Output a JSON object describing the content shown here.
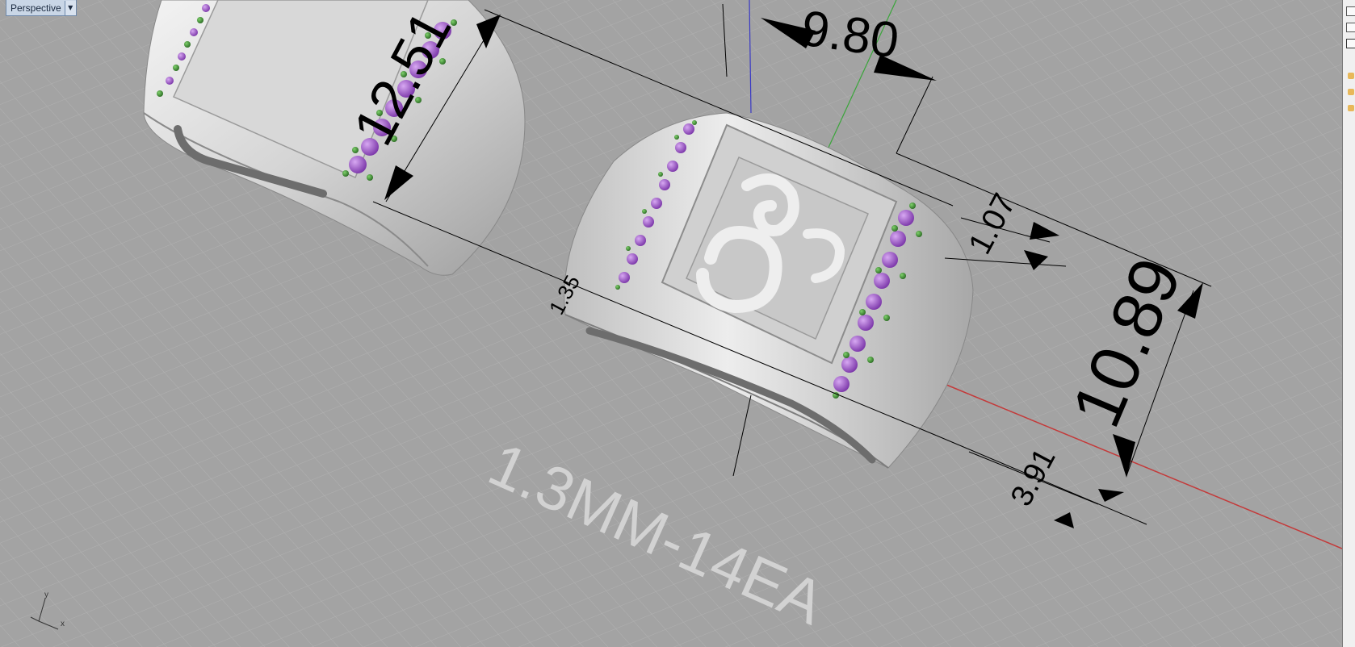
{
  "viewport": {
    "title": "Perspective",
    "menu_icon": "chevron-down-icon",
    "engraving_text": "1.3MM-14EA",
    "axis_labels": {
      "x": "x",
      "y": "y"
    }
  },
  "dimensions": {
    "width_top": "9.80",
    "band_height_left": "12.51",
    "rail_small": "1.07",
    "band_height_right": "10.89",
    "rail_bottom": "3.91",
    "partial_left": "1.35"
  },
  "colors": {
    "background": "#a3a3a3",
    "grid": "#b3b3b3",
    "metal": "#dedede",
    "gem_purple": "#9b55c8",
    "prong_green": "#3a8f2e",
    "axis_x": "#c43a3a",
    "axis_y": "#3aa53a",
    "axis_z": "#3a3ac4"
  },
  "side_panel": {
    "icons": [
      "checkbox-icon",
      "checkbox-icon",
      "lightbulb-icon",
      "lightbulb-icon",
      "lightbulb-icon"
    ]
  }
}
